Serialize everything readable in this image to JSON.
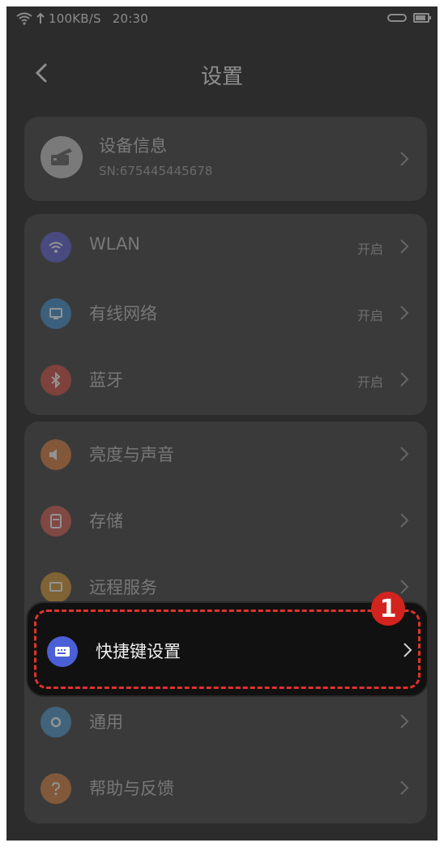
{
  "status_bar": {
    "speed": "100KB/S",
    "time": "20:30"
  },
  "header": {
    "title": "设置"
  },
  "device": {
    "title": "设备信息",
    "sn": "SN:675445445678"
  },
  "network": {
    "items": [
      {
        "label": "WLAN",
        "value": "开启",
        "color": "#5b5fd6"
      },
      {
        "label": "有线网络",
        "value": "开启",
        "color": "#3d8fd1"
      },
      {
        "label": "蓝牙",
        "value": "开启",
        "color": "#d24a3f"
      }
    ]
  },
  "general": {
    "items": [
      {
        "label": "亮度与声音",
        "color": "#d97a3a"
      },
      {
        "label": "存储",
        "color": "#d65a4c"
      },
      {
        "label": "远程服务",
        "color": "#d4952f"
      },
      {
        "label": "快捷键设置",
        "color": "#4b5fd6"
      },
      {
        "label": "通用",
        "color": "#4a97cc"
      },
      {
        "label": "帮助与反馈",
        "color": "#d8803a"
      }
    ]
  },
  "annotation": {
    "badge": "1",
    "color": "#e0322c"
  }
}
